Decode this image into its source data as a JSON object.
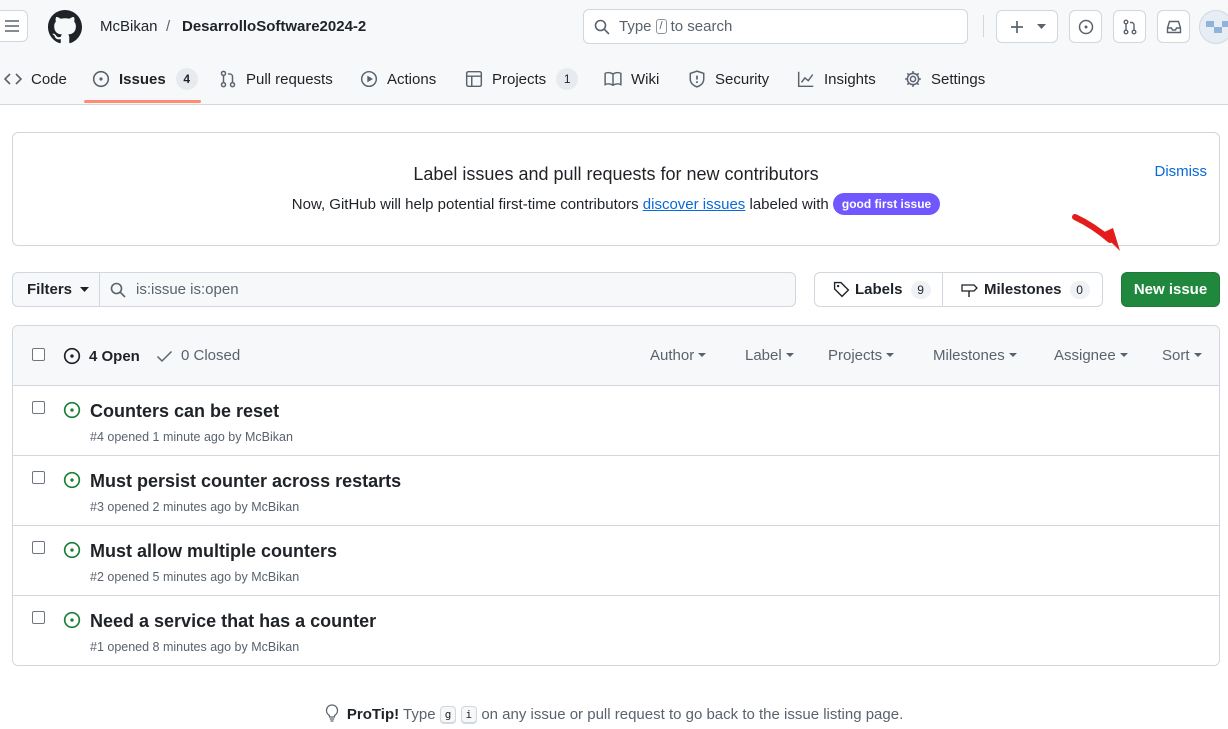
{
  "header": {
    "owner": "McBikan",
    "separator": "/",
    "repo": "DesarrolloSoftware2024-2",
    "search_before": "Type",
    "search_key": "/",
    "search_after": "to search"
  },
  "nav": {
    "tabs": [
      {
        "label": "Code",
        "icon": "code-icon"
      },
      {
        "label": "Issues",
        "icon": "issue-opened-icon",
        "count": "4",
        "selected": true
      },
      {
        "label": "Pull requests",
        "icon": "git-pull-request-icon"
      },
      {
        "label": "Actions",
        "icon": "play-icon"
      },
      {
        "label": "Projects",
        "icon": "table-icon",
        "count": "1"
      },
      {
        "label": "Wiki",
        "icon": "book-icon"
      },
      {
        "label": "Security",
        "icon": "shield-icon"
      },
      {
        "label": "Insights",
        "icon": "graph-icon"
      },
      {
        "label": "Settings",
        "icon": "gear-icon"
      }
    ]
  },
  "banner": {
    "title": "Label issues and pull requests for new contributors",
    "text_before": "Now, GitHub will help potential first-time contributors",
    "link": "discover issues",
    "text_after": "labeled with",
    "label_pill": "good first issue",
    "dismiss": "Dismiss"
  },
  "filterbar": {
    "filters_label": "Filters",
    "query": "is:issue is:open",
    "labels_label": "Labels",
    "labels_count": "9",
    "milestones_label": "Milestones",
    "milestones_count": "0",
    "new_issue_label": "New issue"
  },
  "issues_header": {
    "open_label": "4 Open",
    "closed_label": "0 Closed",
    "filters": [
      "Author",
      "Label",
      "Projects",
      "Milestones",
      "Assignee",
      "Sort"
    ]
  },
  "issues": [
    {
      "title": "Counters can be reset",
      "meta": "#4 opened 1 minute ago by McBikan"
    },
    {
      "title": "Must persist counter across restarts",
      "meta": "#3 opened 2 minutes ago by McBikan"
    },
    {
      "title": "Must allow multiple counters",
      "meta": "#2 opened 5 minutes ago by McBikan"
    },
    {
      "title": "Need a service that has a counter",
      "meta": "#1 opened 8 minutes ago by McBikan"
    }
  ],
  "protip": {
    "lead": "ProTip!",
    "type_word": "Type",
    "key1": "g",
    "key2": "i",
    "rest": "on any issue or pull request to go back to the issue listing page."
  },
  "colors": {
    "accent_green": "#1f883d",
    "open_issue_green": "#1a7f37",
    "link_blue": "#0969da",
    "good_first_issue_purple": "#7057ff",
    "selected_tab_underline": "#fd8c73",
    "annotation_arrow_red": "#e51c1c"
  }
}
